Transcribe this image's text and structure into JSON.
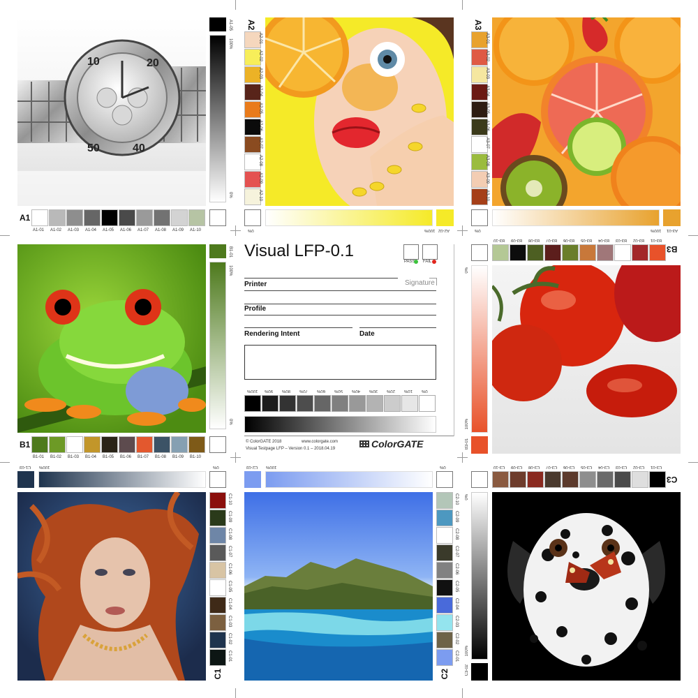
{
  "blocks": {
    "A1": {
      "tag": "A1",
      "bottom_labels": [
        "A1-01",
        "A1-02",
        "A1-03",
        "A1-04",
        "A1-05",
        "A1-06",
        "A1-07",
        "A1-08",
        "A1-09",
        "A1-10"
      ],
      "bottom_colors": [
        "#ffffff",
        "#b9b9b9",
        "#8e8e8e",
        "#666666",
        "#000000",
        "#4a4a4a",
        "#9a9a9a",
        "#727272",
        "#d3d3d3",
        "#b6c4a4"
      ],
      "right_top": "A1-05",
      "right_label_top": "100%",
      "right_label_bottom": "0%"
    },
    "A2": {
      "tag": "A2",
      "left_labels": [
        "A2-01",
        "A2-02",
        "A2-03",
        "A2-04",
        "A2-05",
        "A2-06",
        "A2-07",
        "A2-08",
        "A2-09",
        "A2-10"
      ],
      "left_colors": [
        "#f5d7bd",
        "#f7ee5a",
        "#ecb226",
        "#58241a",
        "#e97b1b",
        "#0b0b0b",
        "#8a4b20",
        "#ffffff",
        "#e45251",
        "#f6f3dc"
      ],
      "bottom_right": "A2-02",
      "grad_start": "100%",
      "grad_end": "0%"
    },
    "A3": {
      "tag": "A3",
      "left_labels": [
        "A3-01",
        "A3-02",
        "A3-03",
        "A3-04",
        "A3-05",
        "A3-06",
        "A3-07",
        "A3-08",
        "A3-09",
        "A3-10"
      ],
      "left_colors": [
        "#e8a22e",
        "#df5a44",
        "#f5e7a0",
        "#6b1a14",
        "#2d1c12",
        "#3b3a1a",
        "#ffffff",
        "#9bbc3e",
        "#f3cdb3",
        "#a53f18"
      ],
      "bottom_right": "A3-01",
      "grad_start": "100%",
      "grad_end": "0%"
    },
    "B1": {
      "tag": "B1",
      "bottom_labels": [
        "B1-01",
        "B1-02",
        "B1-03",
        "B1-04",
        "B1-05",
        "B1-06",
        "B1-07",
        "B1-08",
        "B1-09",
        "B1-10"
      ],
      "bottom_colors": [
        "#4e7a1d",
        "#6d9a26",
        "#ffffff",
        "#c2962a",
        "#2a2418",
        "#5d4b4e",
        "#e3582e",
        "#3c5366",
        "#86a0b2",
        "#7e5a18"
      ],
      "right_top": "B1-01",
      "right_label_top": "100%",
      "right_label_bottom": "0%"
    },
    "B3": {
      "tag": "B3",
      "top_labels": [
        "B3-01",
        "B3-02",
        "B3-03",
        "B3-04",
        "B3-05",
        "B3-06",
        "B3-07",
        "B3-08",
        "B3-09",
        "B3-10"
      ],
      "top_colors": [
        "#e8522a",
        "#a3282a",
        "#ffffff",
        "#a07779",
        "#c8783a",
        "#6a7e2a",
        "#5c1e1c",
        "#4d5f22",
        "#0d0d0d",
        "#b4c895"
      ],
      "left_bottom": "B3-01",
      "grad_top": "0%",
      "grad_bottom": "100%"
    },
    "C1": {
      "tag": "C1",
      "right_labels": [
        "C1-01",
        "C1-02",
        "C1-03",
        "C1-04",
        "C1-05",
        "C1-06",
        "C1-07",
        "C1-08",
        "C1-09",
        "C1-10"
      ],
      "right_colors": [
        "#0d1614",
        "#1f344e",
        "#7c6040",
        "#3f2a18",
        "#ffffff",
        "#d8c4a4",
        "#5a5a5a",
        "#6e86a7",
        "#2a3a1a",
        "#8b0f0c"
      ],
      "top_left": "C1-03",
      "grad_start": "100%",
      "grad_end": "0%"
    },
    "C2": {
      "tag": "C2",
      "right_labels": [
        "C2-01",
        "C2-02",
        "C2-03",
        "C2-04",
        "C2-05",
        "C2-06",
        "C2-07",
        "C2-08",
        "C2-09",
        "C2-10"
      ],
      "right_colors": [
        "#7c9cf0",
        "#6e6348",
        "#94e4ee",
        "#496ada",
        "#111111",
        "#818181",
        "#3a3a2a",
        "#ffffff",
        "#4d98c0",
        "#b3c6b8"
      ],
      "top_left": "C2-03",
      "grad_start": "100%",
      "grad_end": "0%"
    },
    "C3": {
      "tag": "C3",
      "top_labels": [
        "C3-01",
        "C3-02",
        "C3-03",
        "C3-04",
        "C3-05",
        "C3-06",
        "C3-07",
        "C3-08",
        "C3-09",
        "C3-10"
      ],
      "top_colors": [
        "#000000",
        "#dedede",
        "#4a4a4a",
        "#6a6a6a",
        "#8e8e8e",
        "#5c3a2c",
        "#4a3a2e",
        "#8a2a20",
        "#6e3c2c",
        "#8a5a40"
      ],
      "left_bottom": "C3-02",
      "grad_top": "0%",
      "grad_bottom": "100%"
    }
  },
  "center": {
    "title": "Visual LFP-0.1",
    "printer": "Printer",
    "signature": "Signature",
    "profile": "Profile",
    "rendering_intent": "Rendering Intent",
    "date": "Date",
    "pass": "PASS",
    "fail": "FAIL",
    "gray_labels": [
      "100%",
      "90%",
      "80%",
      "70%",
      "60%",
      "50%",
      "40%",
      "30%",
      "20%",
      "10%",
      "0%"
    ],
    "gray_colors": [
      "#000000",
      "#1c1c1c",
      "#333333",
      "#4d4d4d",
      "#666666",
      "#808080",
      "#999999",
      "#b3b3b3",
      "#cccccc",
      "#e6e6e6",
      "#ffffff"
    ],
    "copyright": "© ColorGATE 2018",
    "website": "www.colorgate.com",
    "version": "Visual Testpage LFP – Version 0.1 – 2018.04.19",
    "logo": "ColorGATE"
  },
  "colors": {
    "pass_dot": "#3cc23c",
    "fail_dot": "#e0261e"
  }
}
